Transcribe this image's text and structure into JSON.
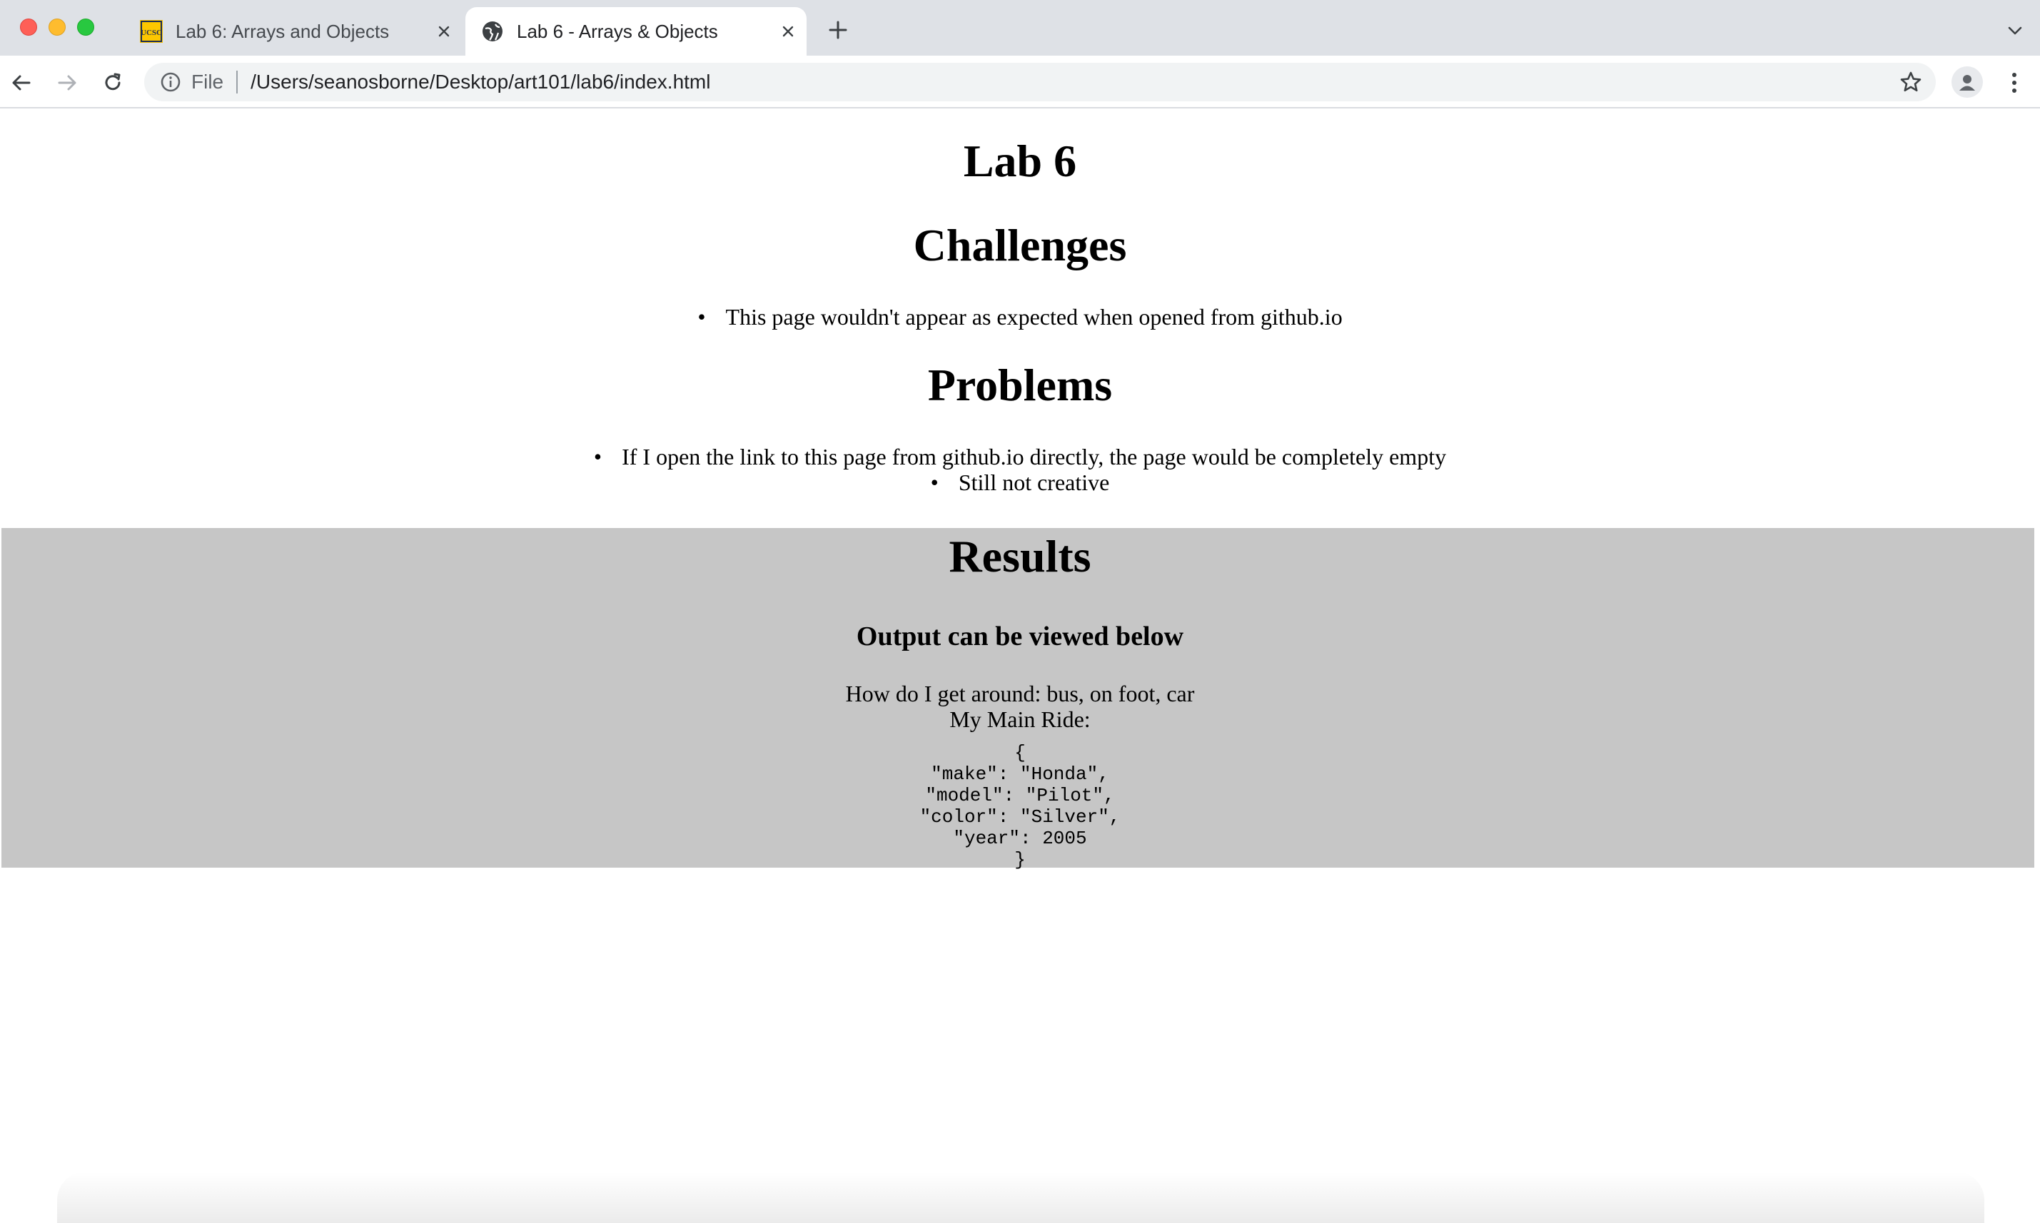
{
  "browser": {
    "tabs": [
      {
        "title": "Lab 6: Arrays and Objects",
        "favicon": "ucsc-logo-icon",
        "active": false
      },
      {
        "title": "Lab 6 - Arrays & Objects",
        "favicon": "globe-icon",
        "active": true
      }
    ],
    "omnibox": {
      "scheme": "File",
      "url": "/Users/seanosborne/Desktop/art101/lab6/index.html"
    },
    "icons": [
      "back-icon",
      "forward-icon",
      "reload-icon",
      "info-icon",
      "star-icon",
      "profile-icon",
      "menu-icon",
      "new-tab-icon",
      "tab-search-icon"
    ],
    "favicon_text": "UCSC"
  },
  "page": {
    "title": "Lab 6",
    "challenges": {
      "heading": "Challenges",
      "items": [
        "This page wouldn't appear as expected when opened from github.io"
      ]
    },
    "problems": {
      "heading": "Problems",
      "items": [
        "If I open the link to this page from github.io directly, the page would be completely empty",
        "Still not creative"
      ]
    },
    "results": {
      "heading": "Results",
      "subheading": "Output can be viewed below",
      "line1": "How do I get around: bus, on foot, car",
      "line2": "My Main Ride:",
      "json_output": "{\n\"make\": \"Honda\",\n\"model\": \"Pilot\",\n\"color\": \"Silver\",\n\"year\": 2005\n}"
    }
  },
  "colors": {
    "tabstrip": "#dee1e6",
    "results_bg": "#c6c6c6",
    "ucsc_gold": "#fdc700"
  }
}
